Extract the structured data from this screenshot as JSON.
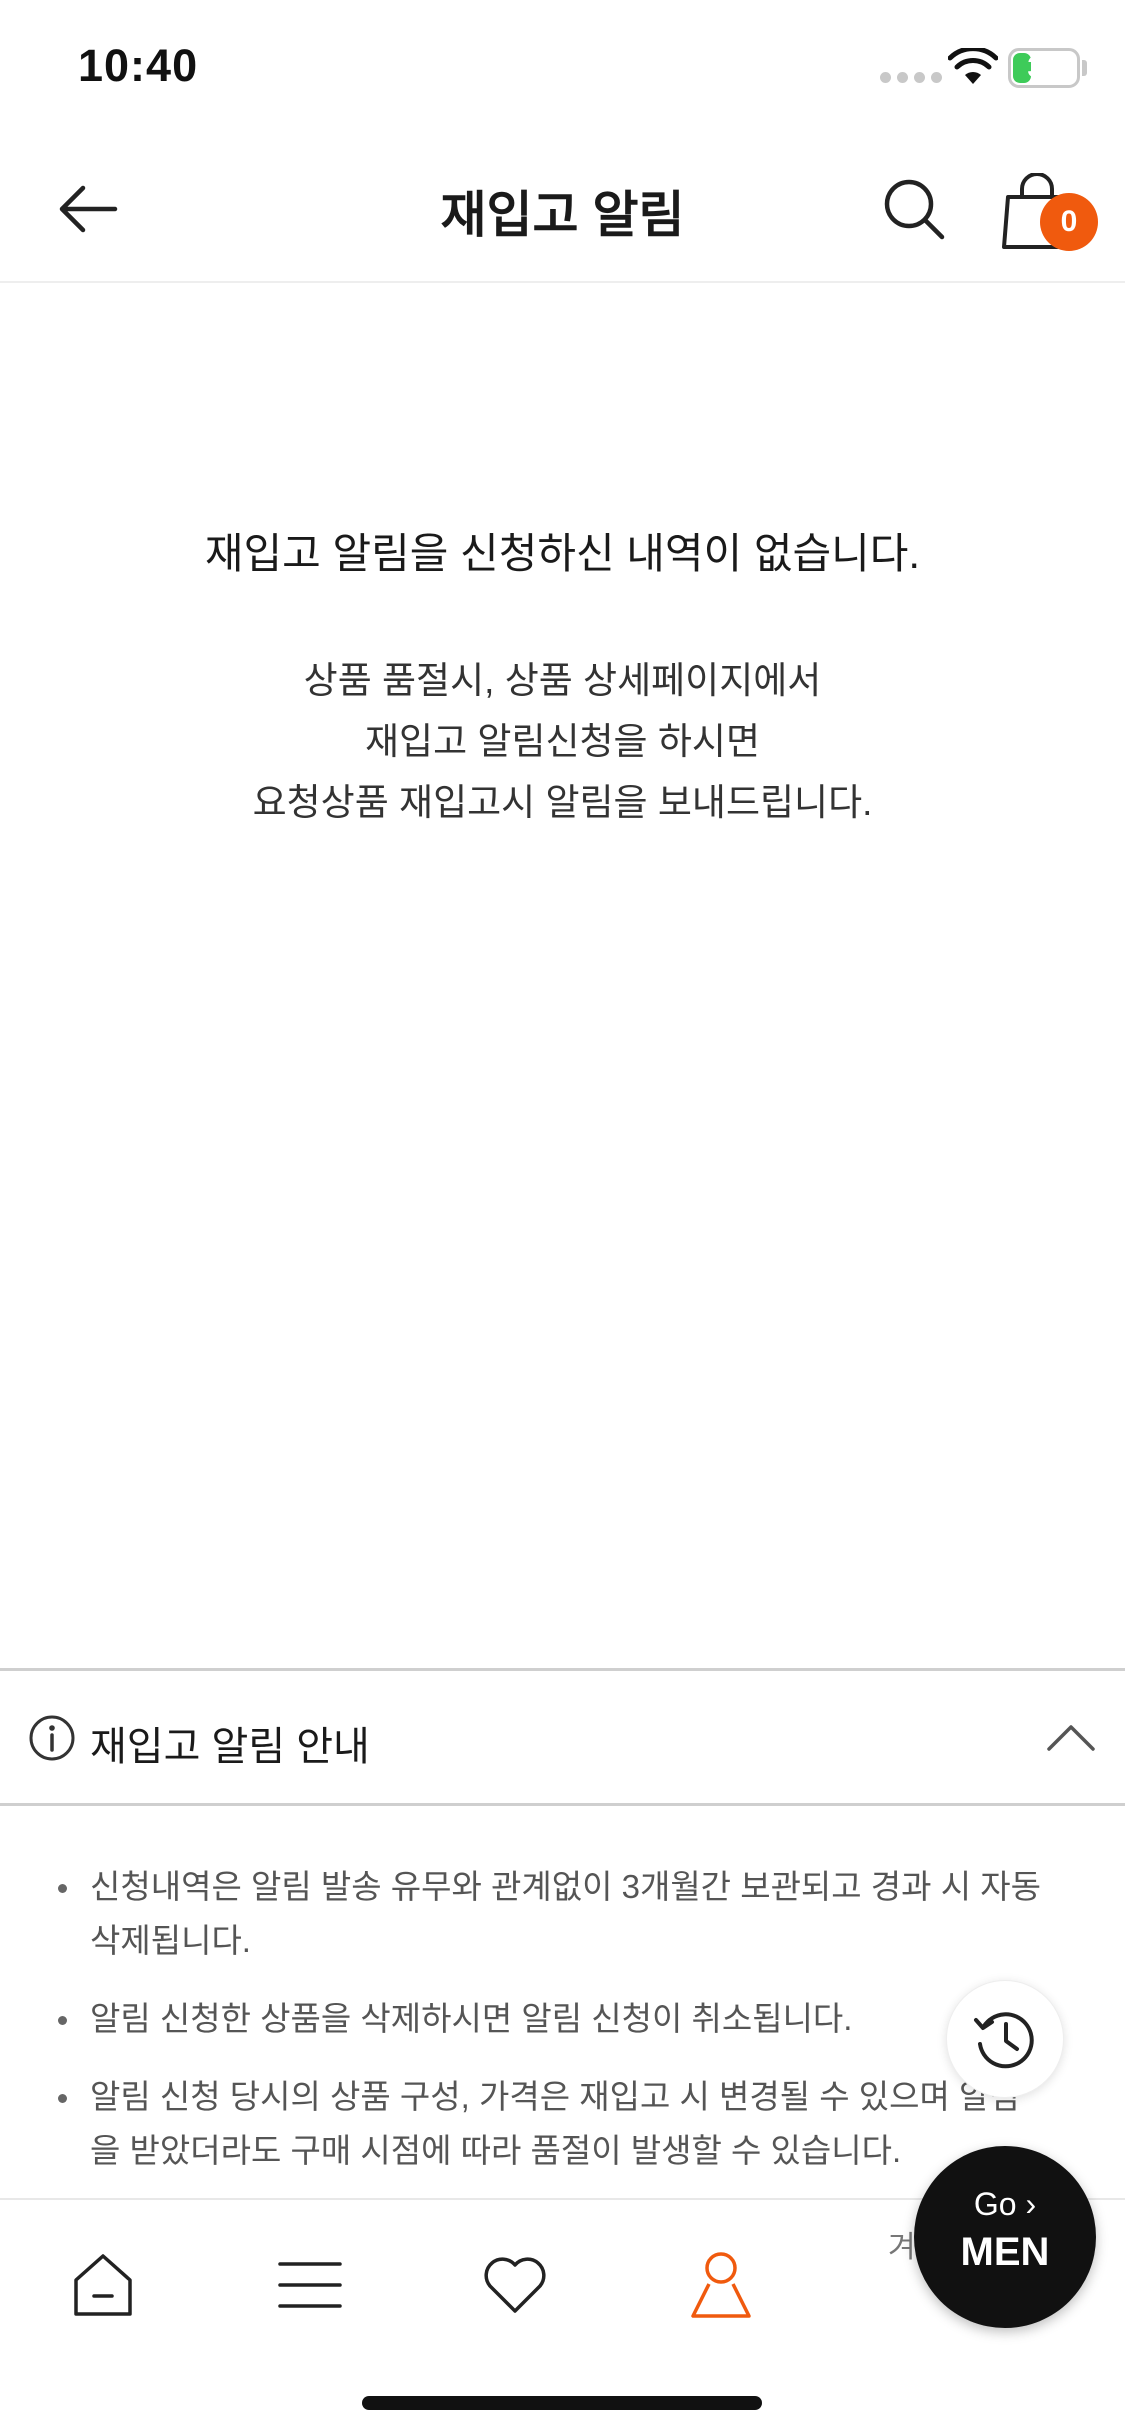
{
  "status_bar": {
    "time": "10:40",
    "battery_level": "33",
    "battery_color": "#3ecb59",
    "icons": [
      "signal-icon",
      "wifi-icon",
      "battery-icon"
    ]
  },
  "header": {
    "title": "재입고 알림",
    "cart_count": "0",
    "accent_color": "#f05a0e",
    "icons": [
      "back-arrow-icon",
      "search-icon",
      "shopping-bag-icon"
    ]
  },
  "empty_state": {
    "title": "재입고 알림을 신청하신 내역이 없습니다.",
    "description_lines": [
      "상품 품절시, 상품 상세페이지에서",
      "재입고 알림신청을 하시면",
      "요청상품 재입고시 알림을 보내드립니다."
    ]
  },
  "notice": {
    "title": "재입고 알림 안내",
    "items": [
      "신청내역은 알림 발송 유무와 관계없이 3개월간 보관되고 경과 시 자동 삭제됩니다.",
      "알림 신청한 상품을 삭제하시면 알림 신청이 취소됩니다.",
      "알림 신청 당시의 상품 구성, 가격은 재입고 시 변경될 수 있으며 알림을 받았더라도 구매 시점에 따라 품절이 발생할 수 있습니다."
    ]
  },
  "floating": {
    "recent_icon": "history-clock-icon",
    "go_label": "Go ›",
    "men_label": "MEN"
  },
  "bottom_nav": {
    "items": [
      "home-icon",
      "menu-icon",
      "heart-icon",
      "person-icon"
    ],
    "active_item": "person-icon",
    "partial_text": "겨"
  }
}
